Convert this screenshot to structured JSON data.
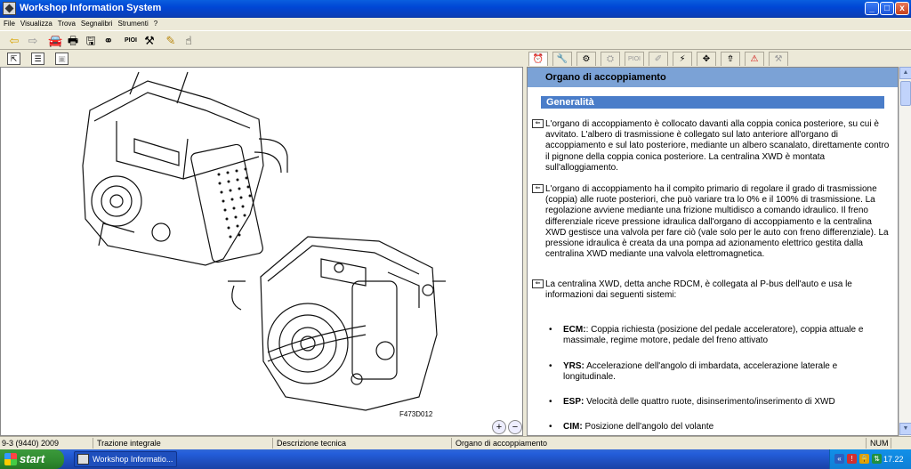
{
  "window": {
    "title": "Workshop Information System",
    "buttons": {
      "minimize": "_",
      "maximize": "□",
      "close": "x"
    }
  },
  "menu": [
    "File",
    "Visualizza",
    "Trova",
    "Segnalibri",
    "Strumenti",
    "?"
  ],
  "toolbar": {
    "pioi_label": "PIOI"
  },
  "right_tabs": {
    "pioi_label": "PIOI"
  },
  "image_pane": {
    "figure_code": "F473D012",
    "zoom_in": "+",
    "zoom_out": "−"
  },
  "document": {
    "header": "Organo di accoppiamento",
    "section": "Generalità",
    "paragraphs": [
      "L'organo di accoppiamento è collocato davanti alla coppia conica posteriore, su cui è avvitato. L'albero di trasmissione è collegato sul lato anteriore all'organo di accoppiamento e sul lato posteriore, mediante un albero scanalato, direttamente contro il pignone della coppia conica posteriore. La centralina XWD è montata sull'alloggiamento.",
      "L'organo di accoppiamento ha il compito primario di regolare il grado di trasmissione (coppia) alle ruote posteriori, che può variare tra lo 0% e il 100% di trasmissione. La regolazione avviene mediante una frizione multidisco a comando idraulico. Il freno differenziale riceve pressione idraulica dall'organo di accoppiamento e la centralina XWD gestisce una valvola per fare ciò (vale solo per le auto con freno differenziale). La pressione idraulica è creata da una pompa ad azionamento elettrico gestita dalla centralina XWD mediante una valvola elettromagnetica.",
      "La centralina XWD, detta anche RDCM, è collegata al P-bus dell'auto e usa le informazioni dai seguenti sistemi:"
    ],
    "bullets": [
      {
        "term": "ECM:",
        "text": ": Coppia richiesta (posizione del pedale acceleratore), coppia attuale e massimale, regime motore, pedale del freno attivato"
      },
      {
        "term": "YRS:",
        "text": " Accelerazione dell'angolo di imbardata, accelerazione laterale e longitudinale."
      },
      {
        "term": "ESP:",
        "text": " Velocità delle quattro ruote, disinserimento/inserimento di XWD"
      },
      {
        "term": "CIM:",
        "text": " Posizione dell'angolo del volante"
      }
    ]
  },
  "status": {
    "model": "9-3 (9440) 2009",
    "system": "Trazione integrale",
    "doc_type": "Descrizione tecnica",
    "topic": "Organo di accoppiamento",
    "num": "NUM"
  },
  "taskbar": {
    "start": "start",
    "task": "Workshop Informatio...",
    "clock": "17.22"
  }
}
